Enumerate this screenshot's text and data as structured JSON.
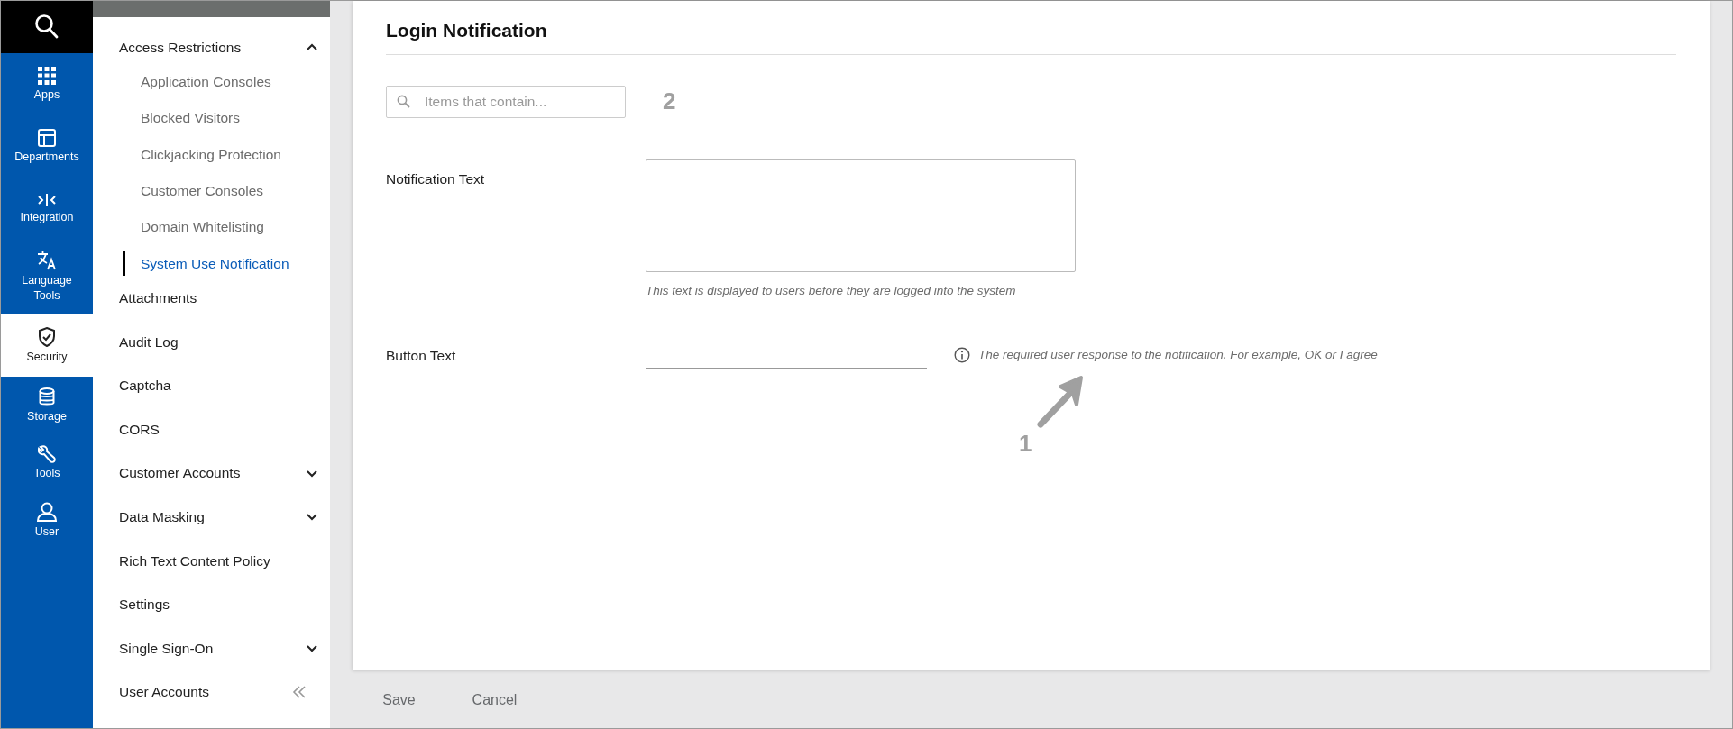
{
  "rail": {
    "items": [
      {
        "label": "Apps",
        "selected": false
      },
      {
        "label": "Departments",
        "selected": false
      },
      {
        "label": "Integration",
        "selected": false
      },
      {
        "label": "Language Tools",
        "selected": false
      },
      {
        "label": "Security",
        "selected": true
      },
      {
        "label": "Storage",
        "selected": false
      },
      {
        "label": "Tools",
        "selected": false
      },
      {
        "label": "User",
        "selected": false
      }
    ]
  },
  "sidebar": {
    "items": [
      {
        "label": "Access Restrictions",
        "selected": false,
        "expanded": true,
        "children": [
          {
            "label": "Application Consoles",
            "selected": false
          },
          {
            "label": "Blocked Visitors",
            "selected": false
          },
          {
            "label": "Clickjacking Protection",
            "selected": false
          },
          {
            "label": "Customer Consoles",
            "selected": false
          },
          {
            "label": "Domain Whitelisting",
            "selected": false
          },
          {
            "label": "System Use Notification",
            "selected": true
          }
        ]
      },
      {
        "label": "Attachments",
        "selected": false
      },
      {
        "label": "Audit Log",
        "selected": false
      },
      {
        "label": "Captcha",
        "selected": false
      },
      {
        "label": "CORS",
        "selected": false
      },
      {
        "label": "Customer Accounts",
        "selected": false,
        "expanded": false
      },
      {
        "label": "Data Masking",
        "selected": false,
        "expanded": false
      },
      {
        "label": "Rich Text Content Policy",
        "selected": false
      },
      {
        "label": "Settings",
        "selected": false
      },
      {
        "label": "Single Sign-On",
        "selected": false,
        "expanded": false
      },
      {
        "label": "User Accounts",
        "selected": false
      }
    ]
  },
  "page": {
    "title": "Login Notification",
    "search": {
      "placeholder": "Items that contain...",
      "annotation": "2"
    },
    "fields": [
      {
        "kind": "textarea",
        "label": "Notification Text",
        "help": "This text is displayed to users before they are logged into the system"
      },
      {
        "kind": "line",
        "label": "Button Text",
        "hint": "The required user response to the notification. For example, OK or I agree",
        "annotation": "1"
      }
    ]
  },
  "buttons": [
    {
      "label": "Save",
      "disabled": true
    },
    {
      "label": "Cancel",
      "disabled": true
    }
  ]
}
